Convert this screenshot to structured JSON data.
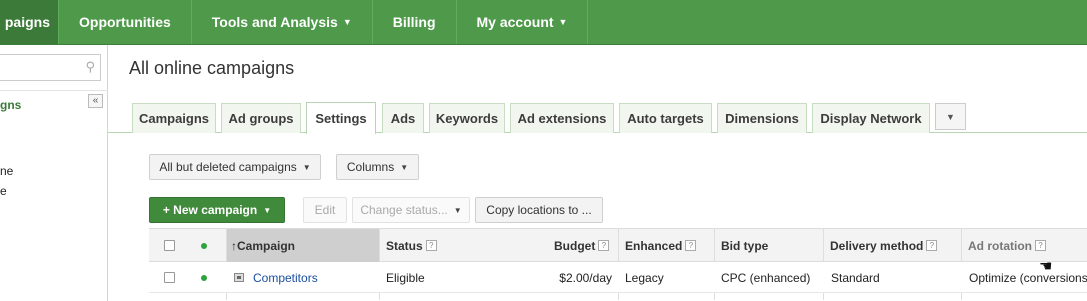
{
  "topnav": {
    "tabs": [
      {
        "label": "paigns",
        "active": true
      },
      {
        "label": "Opportunities",
        "active": false
      },
      {
        "label": "Tools and Analysis",
        "active": false,
        "dropdown": true
      },
      {
        "label": "Billing",
        "active": false
      },
      {
        "label": "My account",
        "active": false,
        "dropdown": true
      }
    ]
  },
  "sidebar": {
    "items": [
      "gns",
      "ne",
      "e"
    ]
  },
  "page": {
    "title": "All online campaigns"
  },
  "tabs": {
    "items": [
      "Campaigns",
      "Ad groups",
      "Settings",
      "Ads",
      "Keywords",
      "Ad extensions",
      "Auto targets",
      "Dimensions",
      "Display Network"
    ],
    "active": "Settings"
  },
  "toolbar": {
    "filter_label": "All but deleted campaigns",
    "columns_label": "Columns",
    "new_campaign_label": "+ New campaign",
    "edit_label": "Edit",
    "change_status_label": "Change status...",
    "copy_locations_label": "Copy locations to ..."
  },
  "table": {
    "headers": {
      "campaign": "Campaign",
      "status": "Status",
      "budget": "Budget",
      "enhanced": "Enhanced",
      "bid_type": "Bid type",
      "delivery_method": "Delivery method",
      "ad_rotation": "Ad rotation"
    },
    "help_glyph": "?",
    "sort_arrow": "↑",
    "rows": [
      {
        "campaign": "Competitors",
        "status": "Eligible",
        "budget": "$2.00/day",
        "enhanced": "Legacy",
        "bid_type": "CPC (enhanced)",
        "delivery_method": "Standard",
        "ad_rotation": "Optimize (conversions)"
      }
    ]
  },
  "colors": {
    "nav_green": "#4e9a4a",
    "active_nav": "#3b7a38",
    "link_blue": "#1a4fa0",
    "status_green": "#2fa33b"
  }
}
